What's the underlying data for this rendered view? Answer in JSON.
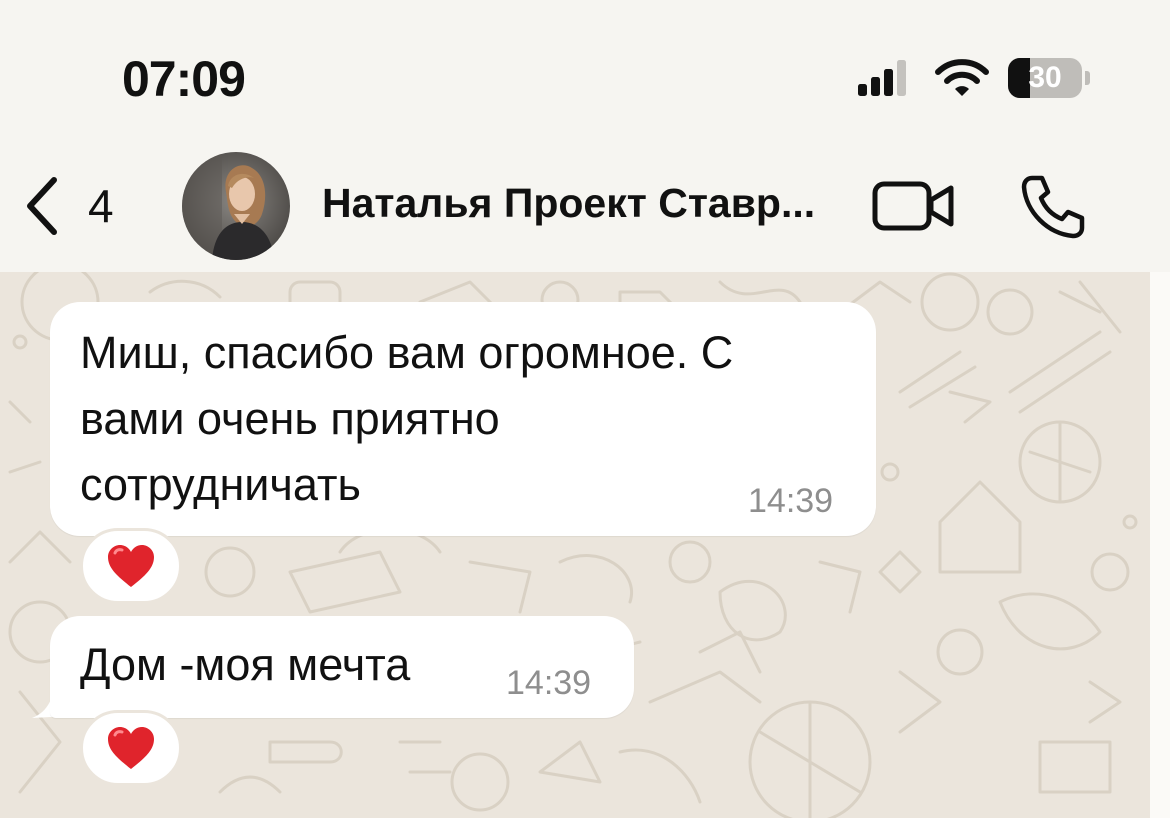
{
  "status_bar": {
    "time": "07:09",
    "battery_level": "30",
    "battery_fraction": 0.3,
    "icons": [
      "cellular-signal-icon",
      "wifi-icon",
      "battery-icon"
    ]
  },
  "header": {
    "back_icon": "chevron-left-icon",
    "back_count": "4",
    "contact_name": "Наталья Проект Ставр...",
    "actions": [
      "video-camera-icon",
      "phone-icon"
    ]
  },
  "messages": [
    {
      "lines": [
        "Миш, спасибо вам огромное. С",
        "вами очень приятно",
        "сотрудничать"
      ],
      "time": "14:39",
      "reaction": "❤️"
    },
    {
      "lines": [
        "Дом -моя мечта"
      ],
      "time": "14:39",
      "reaction": "❤️"
    }
  ],
  "colors": {
    "chat_background": "#ebe5dc",
    "bubble": "#ffffff",
    "header_background": "#f6f5f1",
    "time_text": "#8e8e8e",
    "heart": "#e0242c"
  }
}
